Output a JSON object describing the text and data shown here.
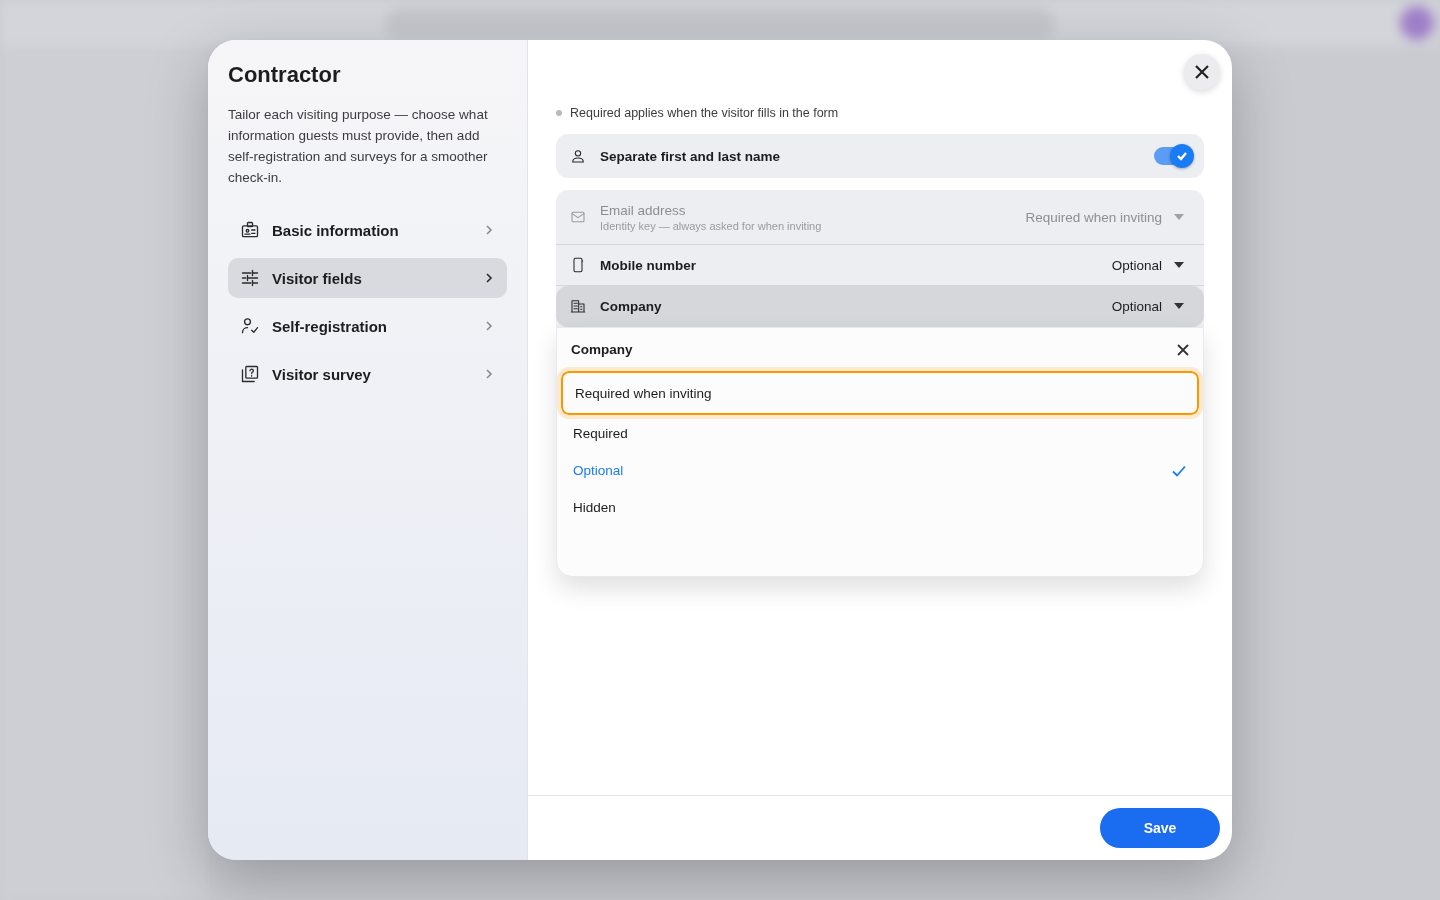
{
  "dialog": {
    "title": "Contractor",
    "description": "Tailor each visiting purpose — choose what information guests must provide, then add self-registration and surveys for a smoother check-in.",
    "nav": [
      {
        "label": "Basic information",
        "selected": false
      },
      {
        "label": "Visitor fields",
        "selected": true
      },
      {
        "label": "Self-registration",
        "selected": false
      },
      {
        "label": "Visitor survey",
        "selected": false
      }
    ],
    "note": "Required applies when the visitor fills in the form",
    "name_toggle": {
      "label": "Separate first and last name",
      "on": true
    },
    "fields": [
      {
        "label": "Email address",
        "sublabel": "Identity key — always asked for when inviting",
        "value": "Required when inviting",
        "disabled": true,
        "open": false
      },
      {
        "label": "Mobile number",
        "value": "Optional",
        "disabled": false,
        "open": false
      },
      {
        "label": "Company",
        "value": "Optional",
        "disabled": false,
        "open": true
      }
    ],
    "dropdown": {
      "title": "Company",
      "options": [
        {
          "label": "Required when inviting",
          "selected": false,
          "focused": true
        },
        {
          "label": "Required",
          "selected": false,
          "focused": false
        },
        {
          "label": "Optional",
          "selected": true,
          "focused": false
        },
        {
          "label": "Hidden",
          "selected": false,
          "focused": false
        }
      ]
    },
    "save_button": "Save"
  }
}
